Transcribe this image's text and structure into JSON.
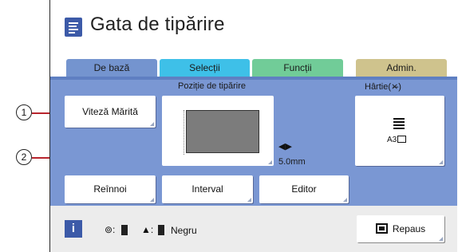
{
  "header": {
    "title": "Gata de tipărire"
  },
  "tabs": [
    {
      "label": "De bază",
      "color": "#7494cf"
    },
    {
      "label": "Selecții",
      "color": "#3ec0e8"
    },
    {
      "label": "Funcții",
      "color": "#71cc98"
    },
    {
      "label": "Admin.",
      "color": "#cfc38d"
    }
  ],
  "main": {
    "speed_button": "Viteză Mărită",
    "print_position_label": "Poziție de tipărire",
    "print_position_value": "5.0mm",
    "paper_label": "Hârtie(",
    "paper_label_end": ")",
    "paper_size": "A3",
    "renew_button": "Reînnoi",
    "interval_button": "Interval",
    "editor_button": "Editor"
  },
  "status": {
    "ink_label": "Negru",
    "sleep_button": "Repaus"
  },
  "callouts": {
    "one": "1",
    "two": "2"
  },
  "colors": {
    "accent": "#3c5aa8",
    "panel": "#7a97d3",
    "callout_line": "#b8242d"
  }
}
